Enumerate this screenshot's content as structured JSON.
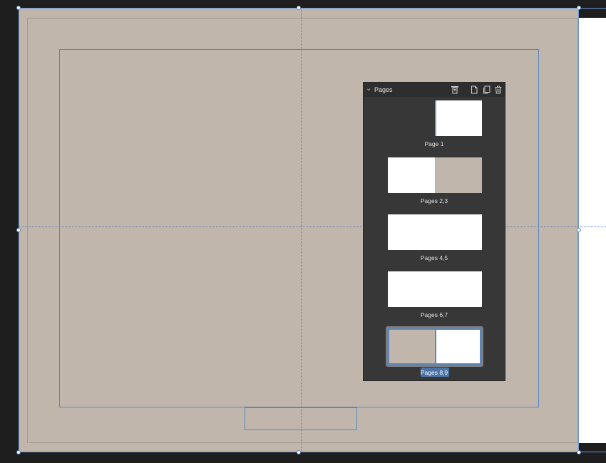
{
  "panel": {
    "title": "Pages",
    "collapse_icon": "chevron-down-icon",
    "toolbar": [
      {
        "name": "master-pages-icon",
        "label": "Master Pages"
      },
      {
        "name": "add-page-icon",
        "label": "Add Page"
      },
      {
        "name": "duplicate-page-icon",
        "label": "Duplicate Page"
      },
      {
        "name": "delete-page-icon",
        "label": "Delete Page"
      }
    ],
    "thumbnails": [
      {
        "label": "Page 1",
        "selected": false
      },
      {
        "label": "Pages 2,3",
        "selected": false
      },
      {
        "label": "Pages 4,5",
        "selected": false
      },
      {
        "label": "Pages 6,7",
        "selected": false
      },
      {
        "label": "Pages 8,9",
        "selected": true
      }
    ]
  },
  "colors": {
    "canvas_background": "#1e1e1e",
    "page_fill": "#c1b6ab",
    "guide_blue": "#5b86c2",
    "panel_background": "#373737",
    "selection_label": "#4b73a6"
  }
}
